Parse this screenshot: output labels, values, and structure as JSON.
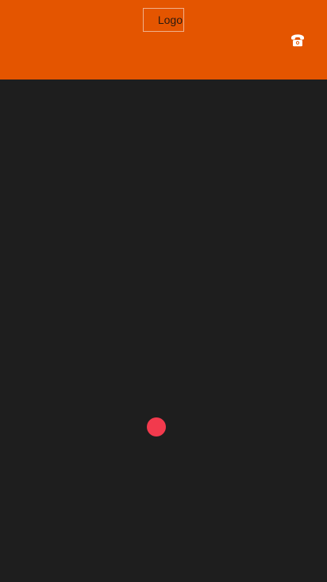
{
  "header": {
    "logo_label": "Logo",
    "call_icon": "telephone-icon",
    "background_color": "#e45500"
  },
  "main": {
    "loading_indicator_color": "#f23a4d",
    "background_color": "#1e1e1e"
  }
}
